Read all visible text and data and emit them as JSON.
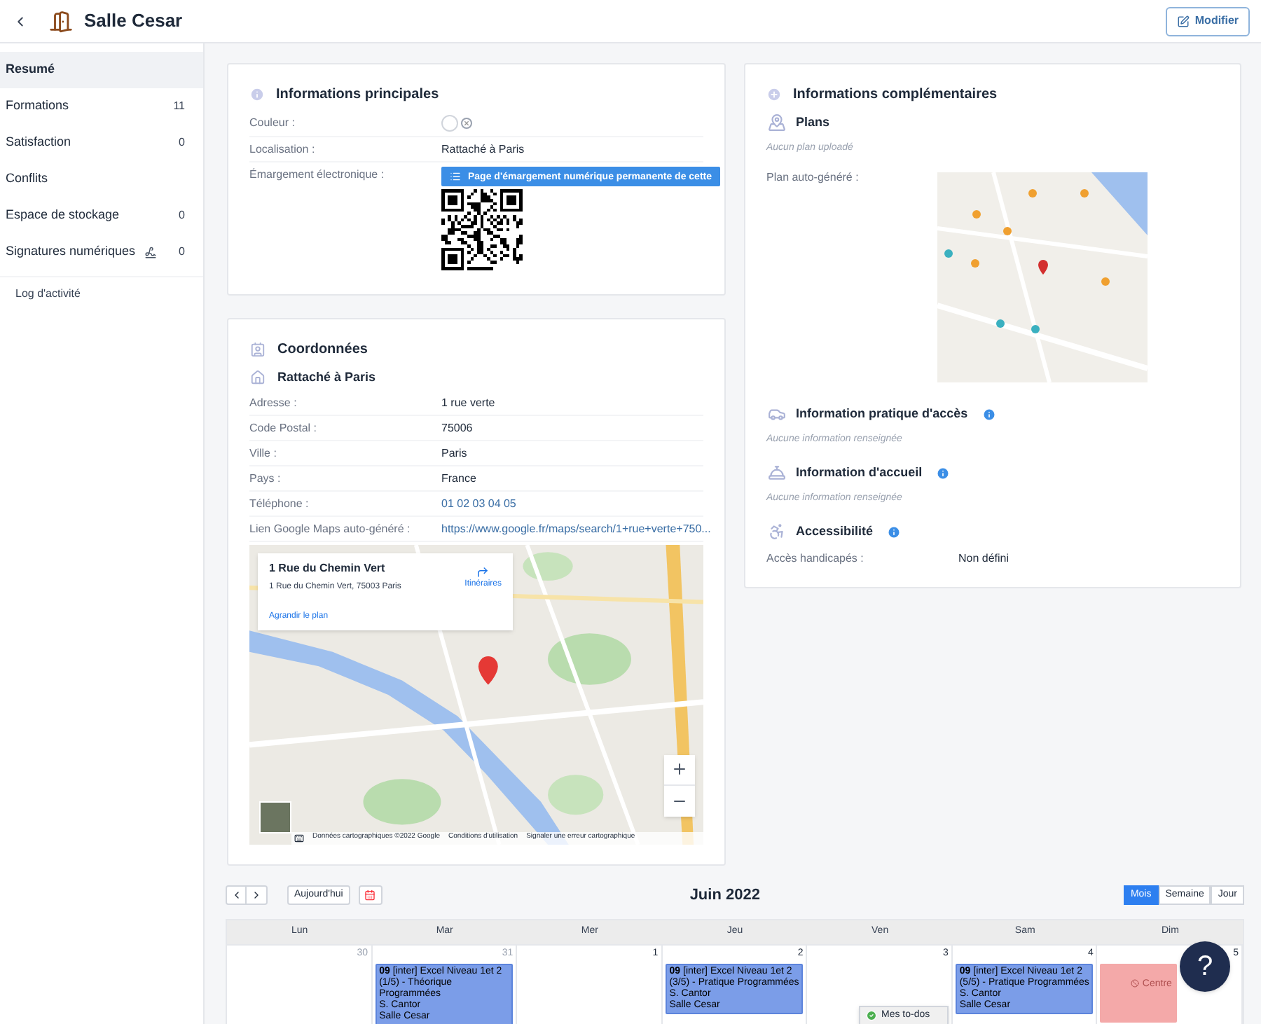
{
  "header": {
    "title": "Salle Cesar",
    "edit_button": "Modifier"
  },
  "sidebar": {
    "items": [
      {
        "label": "Resumé",
        "selected": true,
        "kind": "plain"
      },
      {
        "label": "Formations",
        "count": "11",
        "selected": false,
        "kind": "plain"
      },
      {
        "label": "Satisfaction",
        "count": "0",
        "selected": false,
        "kind": "plain"
      },
      {
        "label": "Conflits",
        "selected": false,
        "kind": "plain"
      },
      {
        "label": "Espace de stockage",
        "count": "0",
        "selected": false,
        "kind": "plain"
      },
      {
        "label": "Signatures numériques",
        "count": "0",
        "selected": false,
        "kind": "signature"
      }
    ],
    "footer_link": "Log d'activité"
  },
  "main_info": {
    "title": "Informations principales",
    "rows": [
      {
        "kind": "color",
        "label": "Couleur :"
      },
      {
        "kind": "text",
        "label": "Localisation :",
        "value": "Rattaché à Paris"
      },
      {
        "kind": "qr",
        "label": "Émargement électronique :",
        "button": "Page d'émargement numérique permanente de cette"
      }
    ]
  },
  "coordinates": {
    "title": "Coordonnées",
    "subtitle": "Rattaché à Paris",
    "rows": [
      {
        "kind": "text",
        "label": "Adresse :",
        "value": "1 rue verte"
      },
      {
        "kind": "text",
        "label": "Code Postal :",
        "value": "75006"
      },
      {
        "kind": "text",
        "label": "Ville :",
        "value": "Paris"
      },
      {
        "kind": "text",
        "label": "Pays :",
        "value": "France"
      },
      {
        "kind": "link",
        "label": "Téléphone :",
        "value": "01 02 03 04 05"
      },
      {
        "kind": "link",
        "label": "Lien Google Maps auto-généré :",
        "value": "https://www.google.fr/maps/search/1+rue+verte+750..."
      }
    ],
    "map": {
      "place_title": "1 Rue du Chemin Vert",
      "place_address": "1 Rue du Chemin Vert, 75003 Paris",
      "directions": "Itinéraires",
      "enlarge": "Agrandir le plan",
      "attribution": [
        "Données cartographiques ©2022 Google",
        "Conditions d'utilisation",
        "Signaler une erreur cartographique"
      ]
    }
  },
  "complementary": {
    "title": "Informations complémentaires",
    "sections": [
      {
        "kind": "plans",
        "title": "Plans",
        "note": "Aucun plan uploadé",
        "label": "Plan auto-généré :"
      },
      {
        "kind": "access",
        "title": "Information pratique d'accès",
        "note": "Aucune information renseignée"
      },
      {
        "kind": "welcome",
        "title": "Information d'accueil",
        "note": "Aucune information renseignée"
      },
      {
        "kind": "accessibility",
        "title": "Accessibilité",
        "label": "Accès handicapés :",
        "value": "Non défini"
      }
    ]
  },
  "calendar": {
    "today": "Aujourd'hui",
    "title": "Juin 2022",
    "views": [
      {
        "label": "Mois",
        "selected": true
      },
      {
        "label": "Semaine",
        "selected": false
      },
      {
        "label": "Jour",
        "selected": false
      }
    ],
    "weekdays": [
      "Lun",
      "Mar",
      "Mer",
      "Jeu",
      "Ven",
      "Sam",
      "Dim"
    ],
    "days": [
      {
        "number": "30",
        "other_month": true
      },
      {
        "number": "31",
        "other_month": true,
        "events": [
          {
            "kind": "session",
            "time": "09",
            "title": "[inter] Excel Niveau 1et 2 (1/5) - Théorique Programmées",
            "trainer": "S. Cantor",
            "room": "Salle Cesar"
          }
        ]
      },
      {
        "number": "1",
        "other_month": false
      },
      {
        "number": "2",
        "other_month": false,
        "events": [
          {
            "kind": "session",
            "time": "09",
            "title": "[inter] Excel Niveau 1et 2 (3/5) - Pratique Programmées",
            "trainer": "S. Cantor",
            "room": "Salle Cesar"
          }
        ]
      },
      {
        "number": "3",
        "other_month": false
      },
      {
        "number": "4",
        "other_month": false,
        "events": [
          {
            "kind": "session",
            "time": "09",
            "title": "[inter] Excel Niveau 1et 2 (5/5) - Pratique Programmées",
            "trainer": "S. Cantor",
            "room": "Salle Cesar"
          }
        ]
      },
      {
        "number": "5",
        "other_month": false,
        "events": [
          {
            "kind": "closed",
            "title": "Centre"
          }
        ]
      }
    ]
  },
  "todos": "Mes to-dos",
  "help_button": "?"
}
